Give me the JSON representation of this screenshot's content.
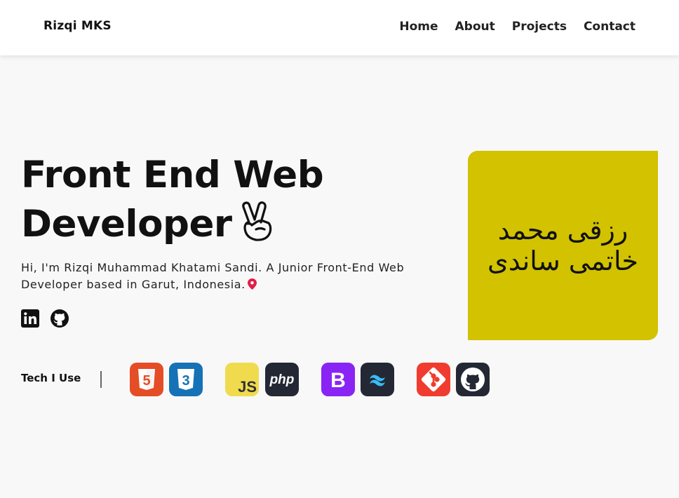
{
  "navbar": {
    "brand": "Rizqi MKS",
    "links": [
      "Home",
      "About",
      "Projects",
      "Contact"
    ]
  },
  "hero": {
    "title_line1": "Front End Web",
    "title_line2": "Developer",
    "title_emoji_icon": "victory-hand-icon",
    "description": "Hi, I'm Rizqi Muhammad Khatami Sandi. A Junior Front-End Web Developer based in Garut, Indonesia.",
    "location_icon": "map-pin-icon"
  },
  "socials": [
    {
      "name": "linkedin-icon"
    },
    {
      "name": "github-icon"
    }
  ],
  "tech": {
    "label": "Tech I Use",
    "icons": [
      {
        "name": "html5-icon",
        "text": "5",
        "color": "#e44d26"
      },
      {
        "name": "css3-icon",
        "text": "3",
        "color": "#1572b6"
      },
      {
        "name": "javascript-icon",
        "text": "JS",
        "color": "#f0db4f"
      },
      {
        "name": "php-icon",
        "text": "php",
        "color": "#232834"
      },
      {
        "name": "bootstrap-icon",
        "text": "B",
        "color": "#7952b3"
      },
      {
        "name": "tailwind-icon",
        "text": "",
        "color": "#232834"
      },
      {
        "name": "git-icon",
        "text": "",
        "color": "#f03c2e"
      },
      {
        "name": "github-icon",
        "text": "",
        "color": "#232834"
      }
    ]
  },
  "logo": {
    "line1": "رزقی محمد",
    "line2": "خاتمی ساندی",
    "background": "#d2c200"
  },
  "colors": {
    "accent": "#111111",
    "page_background": "#f8f8f8",
    "pin": "#e11d48"
  }
}
